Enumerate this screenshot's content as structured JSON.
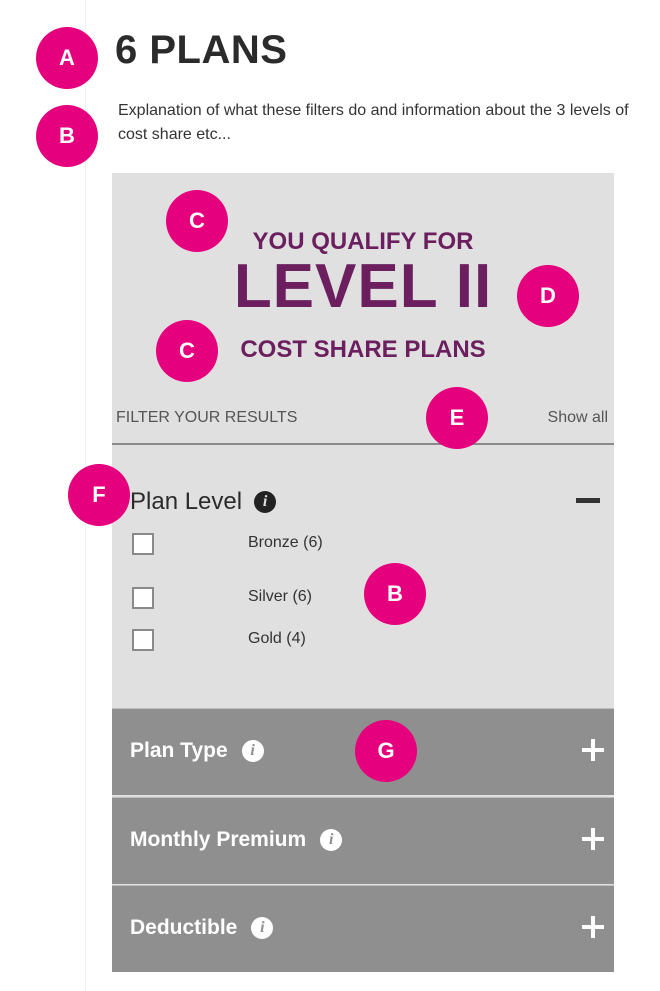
{
  "header": {
    "count_title": "6 PLANS",
    "description": "Explanation of what these filters do and information about the 3 levels of cost share etc..."
  },
  "qualify": {
    "line1": "YOU QUALIFY FOR",
    "level": "LEVEL II",
    "line3": "COST SHARE PLANS",
    "color": "#6b1f5e"
  },
  "filter_bar": {
    "label": "FILTER YOUR RESULTS",
    "show_all": "Show all"
  },
  "plan_level": {
    "title": "Plan Level",
    "info_icon": "info-icon",
    "options": [
      {
        "label": "Bronze (6)",
        "checked": false
      },
      {
        "label": "Silver (6)",
        "checked": false
      },
      {
        "label": "Gold (4)",
        "checked": false
      }
    ]
  },
  "accordions": [
    {
      "title": "Plan Type"
    },
    {
      "title": "Monthly Premium"
    },
    {
      "title": "Deductible"
    }
  ],
  "annotations": {
    "A": "A",
    "B": "B",
    "C": "C",
    "D": "D",
    "E": "E",
    "F": "F",
    "G": "G",
    "color": "#e5007d"
  }
}
